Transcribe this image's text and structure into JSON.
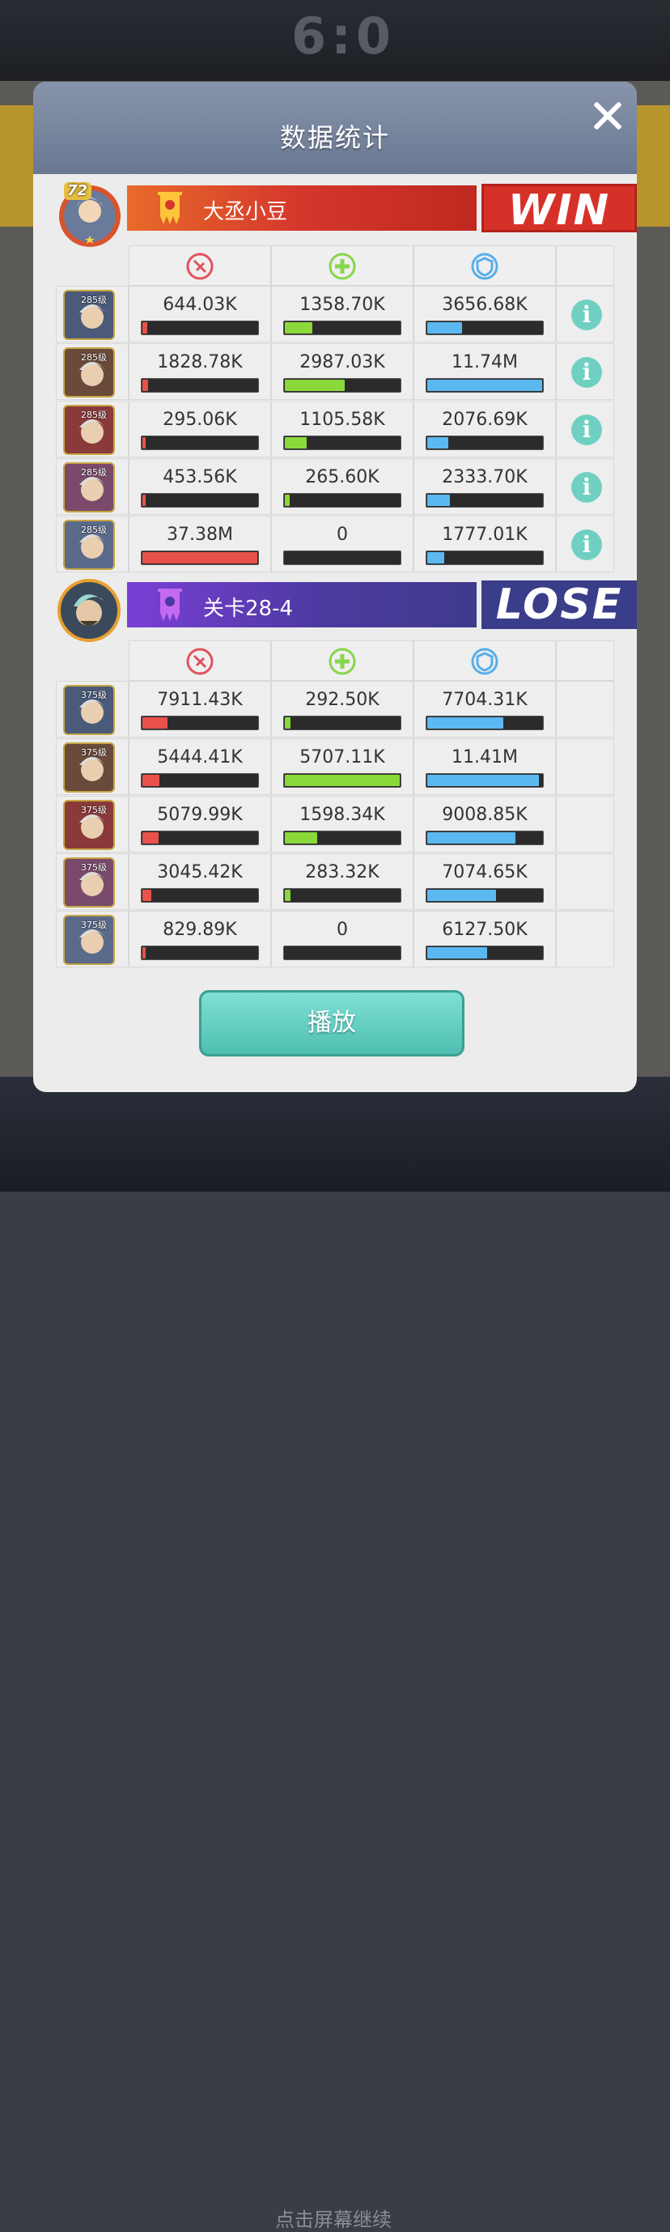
{
  "background": {
    "score": "6:0",
    "bottom_text": "点击屏幕继续"
  },
  "dialog": {
    "title": "数据统计"
  },
  "team1": {
    "name": "大丞小豆",
    "result": "WIN",
    "avatar_level": "72",
    "heroes": [
      {
        "level": "285级",
        "tag": "右",
        "damage": "644.03K",
        "damage_frac": 0.04,
        "heal": "1358.70K",
        "heal_frac": 0.24,
        "tank": "3656.68K",
        "tank_frac": 0.3
      },
      {
        "level": "285级",
        "tag": "右",
        "damage": "1828.78K",
        "damage_frac": 0.05,
        "heal": "2987.03K",
        "heal_frac": 0.52,
        "tank": "11.74M",
        "tank_frac": 1.0
      },
      {
        "level": "285级",
        "tag": "酒",
        "damage": "295.06K",
        "damage_frac": 0.01,
        "heal": "1105.58K",
        "heal_frac": 0.19,
        "tank": "2076.69K",
        "tank_frac": 0.18
      },
      {
        "level": "285级",
        "tag": "内",
        "damage": "453.56K",
        "damage_frac": 0.01,
        "heal": "265.60K",
        "heal_frac": 0.04,
        "tank": "2333.70K",
        "tank_frac": 0.2
      },
      {
        "level": "285级",
        "tag": "左",
        "damage": "37.38M",
        "damage_frac": 1.0,
        "heal": "0",
        "heal_frac": 0,
        "tank": "1777.01K",
        "tank_frac": 0.15
      }
    ]
  },
  "team2": {
    "name": "关卡28-4",
    "result": "LOSE",
    "heroes": [
      {
        "level": "375级",
        "damage": "7911.43K",
        "damage_frac": 0.22,
        "heal": "292.50K",
        "heal_frac": 0.05,
        "tank": "7704.31K",
        "tank_frac": 0.66
      },
      {
        "level": "375级",
        "damage": "5444.41K",
        "damage_frac": 0.15,
        "heal": "5707.11K",
        "heal_frac": 1.0,
        "tank": "11.41M",
        "tank_frac": 0.97
      },
      {
        "level": "375级",
        "damage": "5079.99K",
        "damage_frac": 0.14,
        "heal": "1598.34K",
        "heal_frac": 0.28,
        "tank": "9008.85K",
        "tank_frac": 0.77
      },
      {
        "level": "375级",
        "damage": "3045.42K",
        "damage_frac": 0.08,
        "heal": "283.32K",
        "heal_frac": 0.05,
        "tank": "7074.65K",
        "tank_frac": 0.6
      },
      {
        "level": "375级",
        "damage": "829.89K",
        "damage_frac": 0.02,
        "heal": "0",
        "heal_frac": 0,
        "tank": "6127.50K",
        "tank_frac": 0.52
      }
    ]
  },
  "columns": [
    {
      "icon": "damage-icon",
      "color": "#e0525e"
    },
    {
      "icon": "heal-icon",
      "color": "#86d64a"
    },
    {
      "icon": "shield-icon",
      "color": "#5aaeea"
    }
  ],
  "play_button": {
    "label": "播放"
  }
}
